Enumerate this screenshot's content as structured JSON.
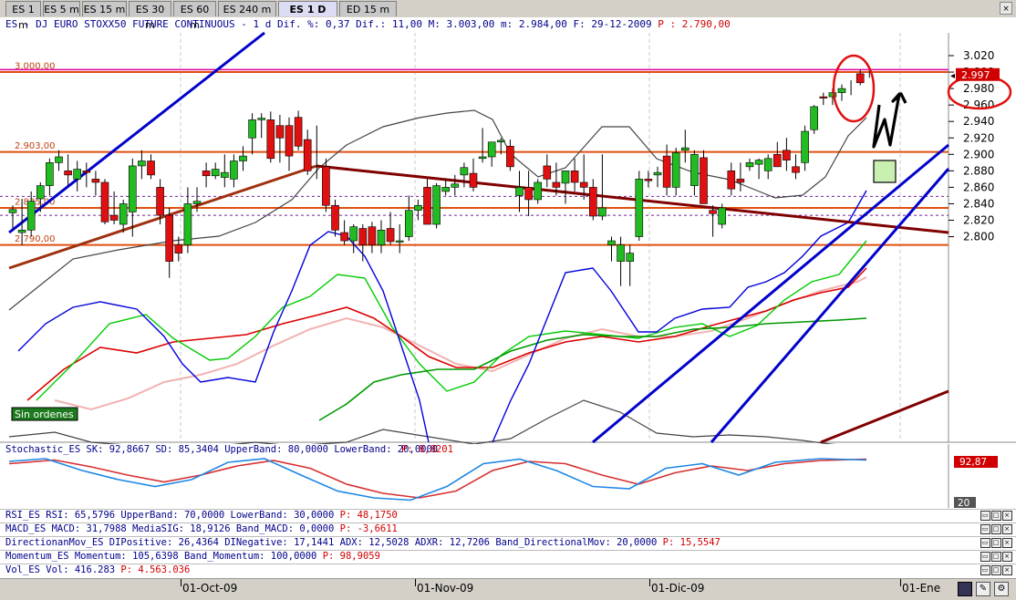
{
  "tabs": [
    {
      "label": "ES 1 m",
      "active": false
    },
    {
      "label": "ES 5 m",
      "active": false
    },
    {
      "label": "ES 15 m",
      "active": false
    },
    {
      "label": "ES 30 m",
      "active": false
    },
    {
      "label": "ES 60 m",
      "active": false
    },
    {
      "label": "ES 240 m",
      "active": false
    },
    {
      "label": "ES 1 D",
      "active": true
    },
    {
      "label": "ED 15 m",
      "active": false
    }
  ],
  "header": {
    "text": "ES - DJ EURO STOXX50 FUTURE CONTINUOUS  -  1 d Dif. %: 0,37 Dif.: 11,00 M: 3.003,00 m: 2.984,00 F: 29-12-2009",
    "p_label": " P : 2.790,00"
  },
  "price_axis": {
    "ticks": [
      "3.020",
      "3.000",
      "2.980",
      "2.960",
      "2.940",
      "2.920",
      "2.900",
      "2.880",
      "2.860",
      "2.840",
      "2.820",
      "2.800"
    ],
    "current": "2.997"
  },
  "level_labels": [
    "3.000,00",
    "2.903,00",
    "2.835,00",
    "2.790,00"
  ],
  "note_label": "Sin ordenes",
  "stochastic": {
    "label": "Stochastic_ES SK: 92,8667 SD: 85,3404 UpperBand: 80,0000 LowerBand: 20,0000",
    "p_label": " P: 8,8201",
    "upper_value": "92,87",
    "lower_value": "20"
  },
  "indicators": [
    {
      "label": "RSI_ES RSI: 65,5796 UpperBand: 70,0000 LowerBand: 30,0000",
      "p_label": " P: 48,1750"
    },
    {
      "label": "MACD_ES MACD: 31,7988 MediaSIG: 18,9126 Band_MACD: 0,0000",
      "p_label": " P: -3,6611"
    },
    {
      "label": "DirectionanMov_ES DIPositive: 26,4364 DINegative: 17,1441 ADX: 12,5028 ADXR: 12,7206 Band_DirectionalMov: 20,0000",
      "p_label": " P: 15,5547"
    },
    {
      "label": "Momentum_ES Momentum: 105,6398 Band_Momentum: 100,0000",
      "p_label": " P: 98,9059"
    },
    {
      "label": "Vol_ES Vol: 416.283",
      "p_label": " P: 4.563.036"
    }
  ],
  "date_axis": [
    "01-Oct-09",
    "01-Nov-09",
    "01-Dic-09",
    "01-Ene"
  ],
  "colors": {
    "up": "#22bb22",
    "down": "#e01010",
    "bb": "#555555",
    "blue": "#0000dd",
    "green": "#00cc00",
    "red_ma": "#dd0000",
    "pink": "#f4b8b8",
    "dkgreen": "#009900",
    "trend_brown": "#a03010",
    "trend_maroon": "#800000",
    "level": "#e05010"
  },
  "chart_data": {
    "type": "candlestick",
    "title": "ES - DJ EURO STOXX50 FUTURE CONTINUOUS - 1 d",
    "ylim": [
      2790,
      3030
    ],
    "x_range": [
      "01-Sep-09",
      "29-Dec-09"
    ],
    "levels": [
      3000,
      2903,
      2835,
      2790
    ],
    "last": 2997,
    "candles": [
      {
        "o": 2829,
        "h": 2838,
        "l": 2810,
        "c": 2833
      },
      {
        "o": 2805,
        "h": 2846,
        "l": 2790,
        "c": 2808
      },
      {
        "o": 2808,
        "h": 2855,
        "l": 2800,
        "c": 2843
      },
      {
        "o": 2846,
        "h": 2866,
        "l": 2830,
        "c": 2862
      },
      {
        "o": 2862,
        "h": 2895,
        "l": 2850,
        "c": 2890
      },
      {
        "o": 2890,
        "h": 2905,
        "l": 2880,
        "c": 2897
      },
      {
        "o": 2880,
        "h": 2900,
        "l": 2862,
        "c": 2875
      },
      {
        "o": 2870,
        "h": 2892,
        "l": 2855,
        "c": 2882
      },
      {
        "o": 2880,
        "h": 2890,
        "l": 2860,
        "c": 2878
      },
      {
        "o": 2870,
        "h": 2880,
        "l": 2850,
        "c": 2866
      },
      {
        "o": 2866,
        "h": 2870,
        "l": 2815,
        "c": 2818
      },
      {
        "o": 2826,
        "h": 2855,
        "l": 2815,
        "c": 2820
      },
      {
        "o": 2815,
        "h": 2845,
        "l": 2805,
        "c": 2840
      },
      {
        "o": 2830,
        "h": 2895,
        "l": 2800,
        "c": 2886
      },
      {
        "o": 2886,
        "h": 2905,
        "l": 2870,
        "c": 2892
      },
      {
        "o": 2892,
        "h": 2900,
        "l": 2870,
        "c": 2875
      },
      {
        "o": 2860,
        "h": 2870,
        "l": 2815,
        "c": 2826
      },
      {
        "o": 2826,
        "h": 2835,
        "l": 2750,
        "c": 2770
      },
      {
        "o": 2790,
        "h": 2800,
        "l": 2770,
        "c": 2780
      },
      {
        "o": 2790,
        "h": 2860,
        "l": 2780,
        "c": 2840
      },
      {
        "o": 2840,
        "h": 2860,
        "l": 2830,
        "c": 2843
      },
      {
        "o": 2880,
        "h": 2890,
        "l": 2860,
        "c": 2874
      },
      {
        "o": 2874,
        "h": 2890,
        "l": 2870,
        "c": 2882
      },
      {
        "o": 2872,
        "h": 2900,
        "l": 2860,
        "c": 2878
      },
      {
        "o": 2870,
        "h": 2900,
        "l": 2860,
        "c": 2892
      },
      {
        "o": 2892,
        "h": 2910,
        "l": 2880,
        "c": 2898
      },
      {
        "o": 2920,
        "h": 2950,
        "l": 2900,
        "c": 2942
      },
      {
        "o": 2942,
        "h": 2950,
        "l": 2920,
        "c": 2944
      },
      {
        "o": 2942,
        "h": 2952,
        "l": 2890,
        "c": 2895
      },
      {
        "o": 2935,
        "h": 2948,
        "l": 2890,
        "c": 2920
      },
      {
        "o": 2935,
        "h": 2945,
        "l": 2880,
        "c": 2898
      },
      {
        "o": 2945,
        "h": 2953,
        "l": 2905,
        "c": 2910
      },
      {
        "o": 2918,
        "h": 2930,
        "l": 2875,
        "c": 2880
      },
      {
        "o": 2910,
        "h": 2935,
        "l": 2870,
        "c": 2910
      },
      {
        "o": 2885,
        "h": 2895,
        "l": 2830,
        "c": 2838
      },
      {
        "o": 2838,
        "h": 2845,
        "l": 2800,
        "c": 2808
      },
      {
        "o": 2805,
        "h": 2820,
        "l": 2790,
        "c": 2795
      },
      {
        "o": 2795,
        "h": 2815,
        "l": 2780,
        "c": 2812
      },
      {
        "o": 2810,
        "h": 2815,
        "l": 2770,
        "c": 2790
      },
      {
        "o": 2812,
        "h": 2818,
        "l": 2780,
        "c": 2790
      },
      {
        "o": 2790,
        "h": 2820,
        "l": 2780,
        "c": 2808
      },
      {
        "o": 2810,
        "h": 2830,
        "l": 2790,
        "c": 2794
      },
      {
        "o": 2794,
        "h": 2815,
        "l": 2780,
        "c": 2795
      },
      {
        "o": 2800,
        "h": 2850,
        "l": 2795,
        "c": 2832
      },
      {
        "o": 2832,
        "h": 2845,
        "l": 2820,
        "c": 2838
      },
      {
        "o": 2860,
        "h": 2870,
        "l": 2815,
        "c": 2815
      },
      {
        "o": 2815,
        "h": 2865,
        "l": 2810,
        "c": 2862
      },
      {
        "o": 2855,
        "h": 2870,
        "l": 2850,
        "c": 2860
      },
      {
        "o": 2860,
        "h": 2875,
        "l": 2850,
        "c": 2864
      },
      {
        "o": 2875,
        "h": 2890,
        "l": 2860,
        "c": 2884
      },
      {
        "o": 2877,
        "h": 2895,
        "l": 2855,
        "c": 2860
      },
      {
        "o": 2895,
        "h": 2932,
        "l": 2890,
        "c": 2897
      },
      {
        "o": 2897,
        "h": 2910,
        "l": 2885,
        "c": 2915
      },
      {
        "o": 2915,
        "h": 2920,
        "l": 2900,
        "c": 2917
      },
      {
        "o": 2910,
        "h": 2918,
        "l": 2880,
        "c": 2885
      },
      {
        "o": 2850,
        "h": 2880,
        "l": 2830,
        "c": 2860
      },
      {
        "o": 2860,
        "h": 2880,
        "l": 2825,
        "c": 2845
      },
      {
        "o": 2845,
        "h": 2870,
        "l": 2840,
        "c": 2866
      },
      {
        "o": 2886,
        "h": 2900,
        "l": 2860,
        "c": 2870
      },
      {
        "o": 2866,
        "h": 2890,
        "l": 2850,
        "c": 2860
      },
      {
        "o": 2865,
        "h": 2880,
        "l": 2840,
        "c": 2880
      },
      {
        "o": 2880,
        "h": 2895,
        "l": 2855,
        "c": 2866
      },
      {
        "o": 2866,
        "h": 2900,
        "l": 2845,
        "c": 2860
      },
      {
        "o": 2860,
        "h": 2870,
        "l": 2820,
        "c": 2825
      },
      {
        "o": 2825,
        "h": 2900,
        "l": 2820,
        "c": 2835
      },
      {
        "o": 2790,
        "h": 2800,
        "l": 2770,
        "c": 2795
      },
      {
        "o": 2770,
        "h": 2800,
        "l": 2740,
        "c": 2790
      },
      {
        "o": 2770,
        "h": 2790,
        "l": 2740,
        "c": 2780
      },
      {
        "o": 2800,
        "h": 2880,
        "l": 2795,
        "c": 2870
      },
      {
        "o": 2870,
        "h": 2880,
        "l": 2860,
        "c": 2868
      },
      {
        "o": 2875,
        "h": 2885,
        "l": 2860,
        "c": 2878
      },
      {
        "o": 2898,
        "h": 2912,
        "l": 2850,
        "c": 2860
      },
      {
        "o": 2860,
        "h": 2908,
        "l": 2850,
        "c": 2902
      },
      {
        "o": 2905,
        "h": 2930,
        "l": 2890,
        "c": 2908
      },
      {
        "o": 2862,
        "h": 2905,
        "l": 2850,
        "c": 2900
      },
      {
        "o": 2896,
        "h": 2905,
        "l": 2855,
        "c": 2840
      },
      {
        "o": 2832,
        "h": 2838,
        "l": 2800,
        "c": 2828
      },
      {
        "o": 2815,
        "h": 2840,
        "l": 2810,
        "c": 2835
      },
      {
        "o": 2880,
        "h": 2890,
        "l": 2850,
        "c": 2858
      },
      {
        "o": 2870,
        "h": 2890,
        "l": 2855,
        "c": 2866
      },
      {
        "o": 2885,
        "h": 2895,
        "l": 2880,
        "c": 2890
      },
      {
        "o": 2888,
        "h": 2895,
        "l": 2870,
        "c": 2893
      },
      {
        "o": 2880,
        "h": 2900,
        "l": 2870,
        "c": 2895
      },
      {
        "o": 2900,
        "h": 2915,
        "l": 2885,
        "c": 2885
      },
      {
        "o": 2905,
        "h": 2920,
        "l": 2880,
        "c": 2893
      },
      {
        "o": 2885,
        "h": 2900,
        "l": 2870,
        "c": 2878
      },
      {
        "o": 2890,
        "h": 2935,
        "l": 2880,
        "c": 2928
      },
      {
        "o": 2930,
        "h": 2960,
        "l": 2925,
        "c": 2958
      },
      {
        "o": 2970,
        "h": 2975,
        "l": 2960,
        "c": 2969
      },
      {
        "o": 2970,
        "h": 2980,
        "l": 2960,
        "c": 2975
      },
      {
        "o": 2975,
        "h": 2985,
        "l": 2965,
        "c": 2980
      },
      {
        "o": 2980,
        "h": 2990,
        "l": 2972,
        "c": 2980
      },
      {
        "o": 2998,
        "h": 3003,
        "l": 2984,
        "c": 2987
      },
      {
        "o": 2997,
        "h": 3003,
        "l": 2993,
        "c": 2997
      }
    ],
    "stochastic": {
      "sk": 92.8667,
      "sd": 85.3404,
      "upper": 80,
      "lower": 20
    }
  }
}
